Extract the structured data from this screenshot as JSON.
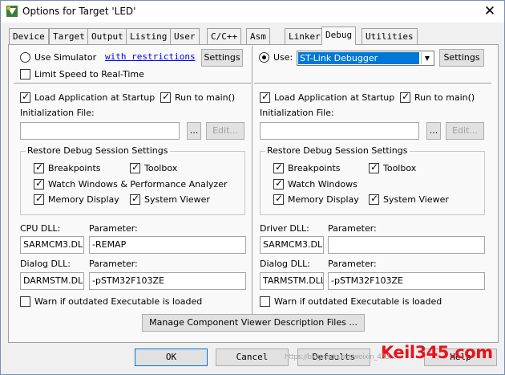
{
  "window": {
    "title": "Options for Target 'LED'",
    "close_glyph": "✕"
  },
  "tabs": [
    {
      "label": "Device"
    },
    {
      "label": "Target"
    },
    {
      "label": "Output"
    },
    {
      "label": "Listing"
    },
    {
      "label": "User"
    },
    {
      "label": "C/C++"
    },
    {
      "label": "Asm"
    },
    {
      "label": "Linker"
    },
    {
      "label": "Debug",
      "active": true
    },
    {
      "label": "Utilities"
    }
  ],
  "left": {
    "use_simulator": {
      "label": "Use Simulator",
      "checked": false
    },
    "with_restrictions": "with restrictions",
    "settings_button": "Settings",
    "limit_speed": {
      "label": "Limit Speed to Real-Time",
      "checked": false
    },
    "load_app": {
      "label": "Load Application at Startup",
      "checked": true
    },
    "run_to_main": {
      "label": "Run to main()",
      "checked": true
    },
    "init_file_label": "Initialization File:",
    "init_file_value": "",
    "browse_button": "...",
    "edit_button": "Edit...",
    "restore_group": "Restore Debug Session Settings",
    "breakpoints": {
      "label": "Breakpoints",
      "checked": true
    },
    "toolbox": {
      "label": "Toolbox",
      "checked": true
    },
    "watch_windows": {
      "label": "Watch Windows & Performance Analyzer",
      "checked": true
    },
    "memory_display": {
      "label": "Memory Display",
      "checked": true
    },
    "system_viewer": {
      "label": "System Viewer",
      "checked": true
    },
    "dll_label": "CPU DLL:",
    "param_label": "Parameter:",
    "dll_value": "SARMCM3.DLL",
    "dll_param": "-REMAP",
    "dialog_dll_label": "Dialog DLL:",
    "dialog_param_label": "Parameter:",
    "dialog_dll_value": "DARMSTM.DLL",
    "dialog_param": "-pSTM32F103ZE",
    "warn": {
      "label": "Warn if outdated Executable is loaded",
      "checked": false
    }
  },
  "right": {
    "use": {
      "label": "Use:",
      "checked": true
    },
    "debugger_select": "ST-Link Debugger",
    "settings_button": "Settings",
    "load_app": {
      "label": "Load Application at Startup",
      "checked": true
    },
    "run_to_main": {
      "label": "Run to main()",
      "checked": true
    },
    "init_file_label": "Initialization File:",
    "init_file_value": "",
    "browse_button": "...",
    "edit_button": "Edit...",
    "restore_group": "Restore Debug Session Settings",
    "breakpoints": {
      "label": "Breakpoints",
      "checked": true
    },
    "toolbox": {
      "label": "Toolbox",
      "checked": true
    },
    "watch_windows": {
      "label": "Watch Windows",
      "checked": true
    },
    "memory_display": {
      "label": "Memory Display",
      "checked": true
    },
    "system_viewer": {
      "label": "System Viewer",
      "checked": true
    },
    "dll_label": "Driver DLL:",
    "param_label": "Parameter:",
    "dll_value": "SARMCM3.DLL",
    "dll_param": "",
    "dialog_dll_label": "Dialog DLL:",
    "dialog_param_label": "Parameter:",
    "dialog_dll_value": "TARMSTM.DLL",
    "dialog_param": "-pSTM32F103ZE",
    "warn": {
      "label": "Warn if outdated Executable is loaded",
      "checked": false
    }
  },
  "manage_button": "Manage Component Viewer Description Files ...",
  "footer": {
    "ok": "OK",
    "cancel": "Cancel",
    "defaults": "Defaults",
    "help": "Help"
  },
  "watermark": {
    "text": "Keil345.com",
    "faint": "https://blog.csdn.net/weixin_433..."
  },
  "colors": {
    "accent": "#0078d7",
    "watermark": "#e8121b"
  }
}
